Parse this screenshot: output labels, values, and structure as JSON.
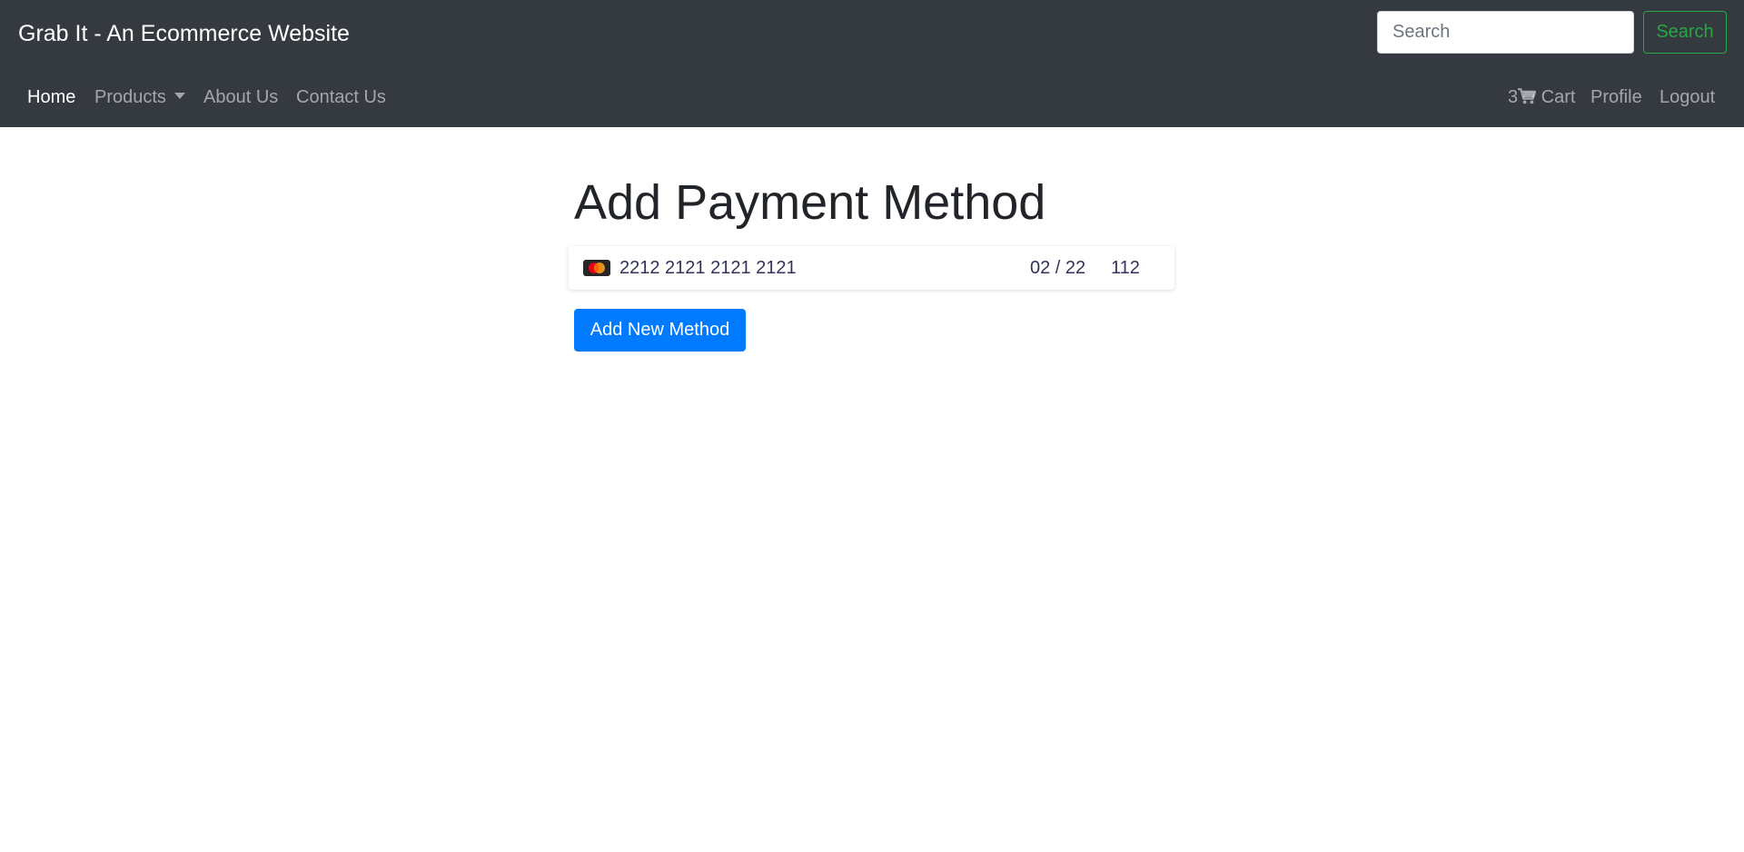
{
  "navbar": {
    "brand": "Grab It - An Ecommerce Website",
    "search": {
      "placeholder": "Search",
      "button_label": "Search"
    },
    "left_links": {
      "home": "Home",
      "products": "Products",
      "about": "About Us",
      "contact": "Contact Us"
    },
    "right_links": {
      "cart_count": "3",
      "cart_label": " Cart",
      "profile": "Profile",
      "logout": "Logout"
    },
    "colors": {
      "background": "#343a40",
      "search_accent": "#28a745"
    }
  },
  "main": {
    "title": "Add Payment Method",
    "card": {
      "brand_icon": "mastercard-icon",
      "number": "2212 2121 2121 2121",
      "expiry": "02 / 22",
      "cvc": "112"
    },
    "add_button_label": "Add New Method",
    "colors": {
      "primary": "#007bff"
    }
  },
  "icons": {
    "cart": "shopping-cart-icon",
    "dropdown": "caret-down-icon"
  }
}
